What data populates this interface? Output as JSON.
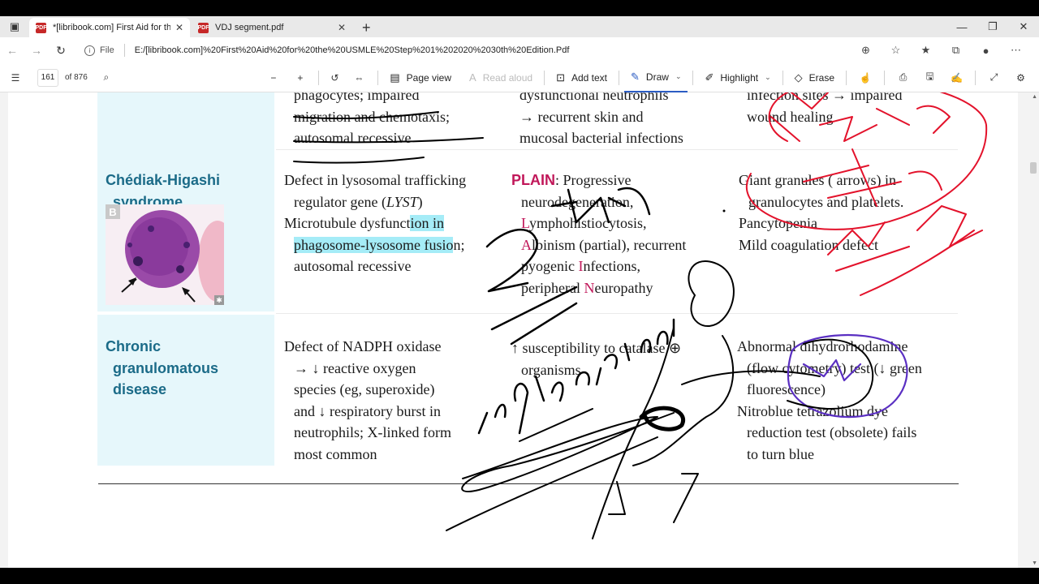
{
  "browser": {
    "tabs": [
      {
        "title": "*[libribook.com] First Aid for the",
        "active": true
      },
      {
        "title": "VDJ segment.pdf",
        "active": false
      }
    ],
    "address": {
      "scheme_label": "File",
      "url": "E:/[libribook.com]%20First%20Aid%20for%20the%20USMLE%20Step%201%202020%2030th%20Edition.Pdf"
    }
  },
  "pdf_toolbar": {
    "page_current": "161",
    "page_total": "of 876",
    "page_view": "Page view",
    "read_aloud": "Read aloud",
    "add_text": "Add text",
    "draw": "Draw",
    "highlight": "Highlight",
    "erase": "Erase"
  },
  "document": {
    "top_row": {
      "col1": [
        "phagocytes; impaired",
        "migration and chemotaxis;",
        "autosomal recessive"
      ],
      "col2": [
        "dysfunctional neutrophils",
        "→ recurrent skin and",
        "mucosal bacterial infections"
      ],
      "col3": [
        "infection sites → impaired",
        "wound healing"
      ]
    },
    "chediak": {
      "name_line1": "Chédiak-Higashi",
      "name_line2": "syndrome",
      "figure_label": "B",
      "pathophys": {
        "l1": "Defect in lysosomal trafficking",
        "l2a": "regulator gene (",
        "l2b": "LYST",
        "l2c": ")",
        "l3a": "Microtubule dysfunct",
        "l3b": "ion in",
        "l4a": "phagosome-lysosome fusio",
        "l4b": "n;",
        "l5": "autosomal recessive"
      },
      "clinical": {
        "mnemonic": "PLAIN",
        "l1rest": ": Progressive",
        "l2": "neurodegeneration,",
        "l3a": "L",
        "l3b": "ymphohistiocytosis,",
        "l4a": "A",
        "l4b": "lbinism (partial), recurrent",
        "l5a": "pyogenic ",
        "l5b": "I",
        "l5c": "nfections,",
        "l6a": "peripheral ",
        "l6b": "N",
        "l6c": "europathy"
      },
      "labs": {
        "l1": "Giant granules (   arrows) in",
        "l2": "granulocytes and platelets.",
        "l3": "Pancytopenia",
        "l4": "Mild coagulation defect"
      }
    },
    "cgd": {
      "name_line1": "Chronic",
      "name_line2": "granulomatous",
      "name_line3": "disease",
      "pathophys": {
        "l1": "Defect of NADPH oxidase",
        "l2": "→ ↓ reactive oxygen",
        "l3": "species (eg, superoxide)",
        "l4": "and ↓ respiratory burst in",
        "l5": "neutrophils; X-linked form",
        "l6": "most common"
      },
      "clinical": {
        "l1": "↑ susceptibility to catalase ⊕",
        "l2": "organisms"
      },
      "labs": {
        "l1": "Abnormal dihydrorhodamine",
        "l2": "(flow cytometry) test (↓ green",
        "l3": "fluorescence)",
        "l4": "Nitroblue tetrazolium dye",
        "l5": "reduction test (obsolete) fails",
        "l6": "to turn blue"
      }
    }
  },
  "colors": {
    "accent_teal": "#1b6b88",
    "mnemonic_pink": "#c1185a",
    "name_column_bg": "#e6f7fb",
    "text_highlight": "#a5ecf7",
    "ink_red": "#e3122b",
    "ink_purple": "#5a2fc2",
    "ink_black": "#000000",
    "draw_active": "#2b5cc3"
  }
}
